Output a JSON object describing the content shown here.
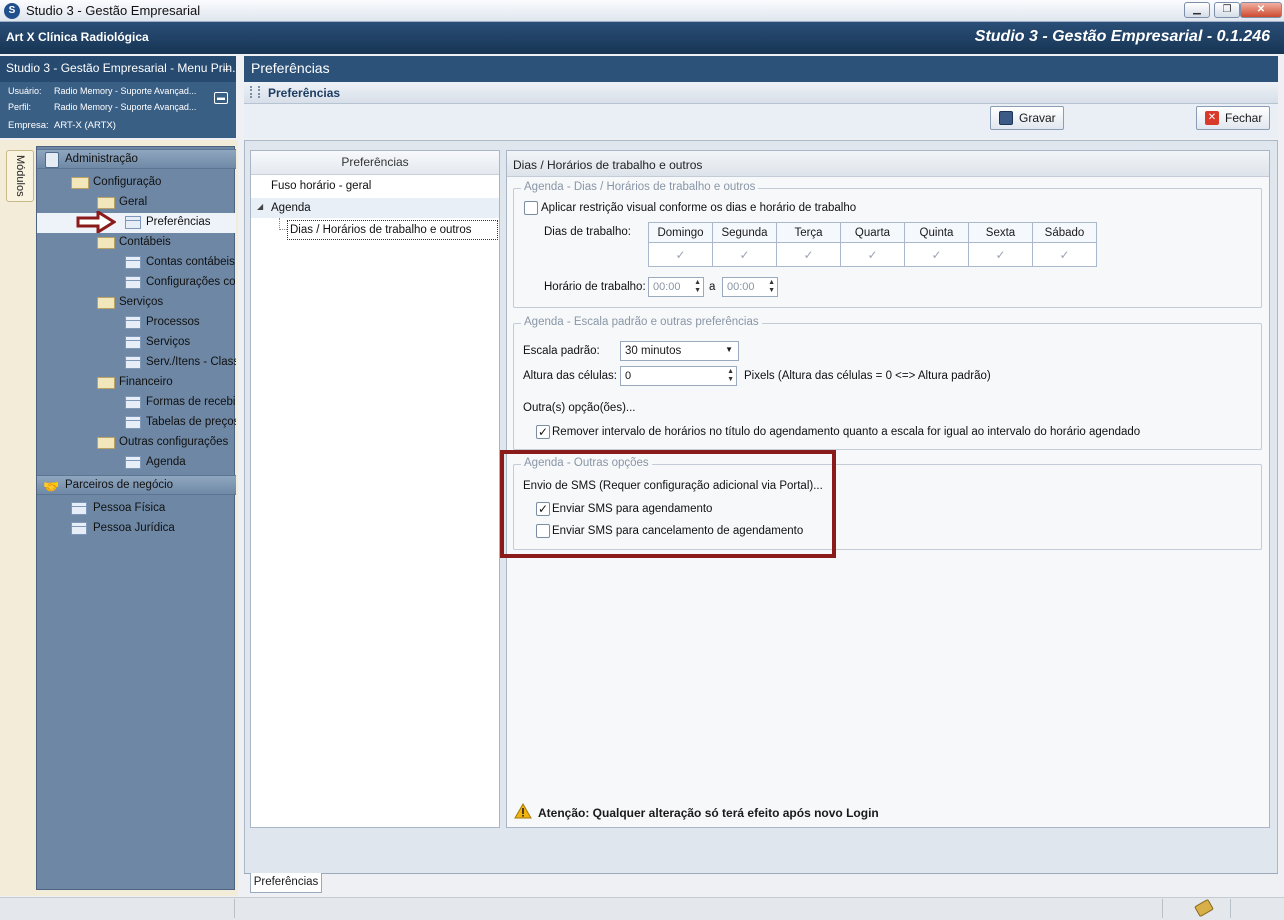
{
  "window": {
    "title": "Studio 3 - Gestão Empresarial",
    "icon": "studio-logo-icon"
  },
  "appbar": {
    "company": "Art X Clínica Radiológica",
    "version": "Studio 3 - Gestão Empresarial - 0.1.246"
  },
  "left_panel": {
    "title": "Studio 3 - Gestão Empresarial - Menu Prin...",
    "user_label": "Usuário:",
    "user_value": "Radio Memory - Suporte Avançad...",
    "profile_label": "Perfil:",
    "profile_value": "Radio Memory - Suporte Avançad...",
    "company_label": "Empresa:",
    "company_value": "ART-X (ARTX)",
    "modules_tab": "Módulos",
    "tree": {
      "admin": "Administração",
      "configuracao": "Configuração",
      "geral": "Geral",
      "preferencias": "Preferências",
      "contabeis": "Contábeis",
      "contas_contabeis": "Contas contábeis (",
      "configuracoes_con": "Configurações con",
      "servicos_folder": "Serviços",
      "processos": "Processos",
      "servicos": "Serviços",
      "serv_itens": "Serv./Itens - Class",
      "financeiro": "Financeiro",
      "formas_receb": "Formas de recebim",
      "tabelas_precos": "Tabelas de preços",
      "outras_config": "Outras configurações",
      "agenda": "Agenda",
      "parceiros": "Parceiros de negócio",
      "pessoa_fisica": "Pessoa Física",
      "pessoa_juridica": "Pessoa Jurídica"
    }
  },
  "main": {
    "header": "Preferências",
    "subheader": "Preferências",
    "toolbar": {
      "save": "Gravar",
      "close": "Fechar"
    },
    "pref_tree": {
      "header": "Preferências",
      "fuso": "Fuso horário - geral",
      "agenda": "Agenda",
      "dias": "Dias / Horários de trabalho e outros"
    },
    "panel": {
      "title": "Dias / Horários de trabalho e outros",
      "group1": {
        "legend": "Agenda - Dias / Horários de trabalho e outros",
        "restrict": "Aplicar restrição visual conforme os dias e horário de trabalho",
        "restrict_checked": false,
        "days_label": "Dias de trabalho:",
        "days": [
          "Domingo",
          "Segunda",
          "Terça",
          "Quarta",
          "Quinta",
          "Sexta",
          "Sábado"
        ],
        "hours_label": "Horário de trabalho:",
        "hour_from": "00:00",
        "hour_sep": "a",
        "hour_to": "00:00"
      },
      "group2": {
        "legend": "Agenda - Escala padrão e outras preferências",
        "scale_label": "Escala padrão:",
        "scale_value": "30 minutos",
        "height_label": "Altura das células:",
        "height_value": "0",
        "height_unit": "Pixels  (Altura das células = 0 <=> Altura padrão)",
        "other_options": "Outra(s) opção(ões)...",
        "remove_interval": "Remover intervalo de horários no título do agendamento quanto a escala for igual ao intervalo do horário agendado",
        "remove_interval_checked": true
      },
      "group3": {
        "legend": "Agenda - Outras opções",
        "sms_label": "Envio de SMS (Requer configuração adicional via Portal)...",
        "sms_schedule": "Enviar SMS para agendamento",
        "sms_schedule_checked": true,
        "sms_cancel": "Enviar SMS para cancelamento de agendamento",
        "sms_cancel_checked": false
      },
      "warning": "Atenção: Qualquer alteração só terá efeito após novo Login"
    },
    "bottom_tab": "Preferências"
  },
  "colors": {
    "highlight": "#8b1a1a",
    "nav_bg": "#6d87a4",
    "header_bg": "#2c5279"
  }
}
